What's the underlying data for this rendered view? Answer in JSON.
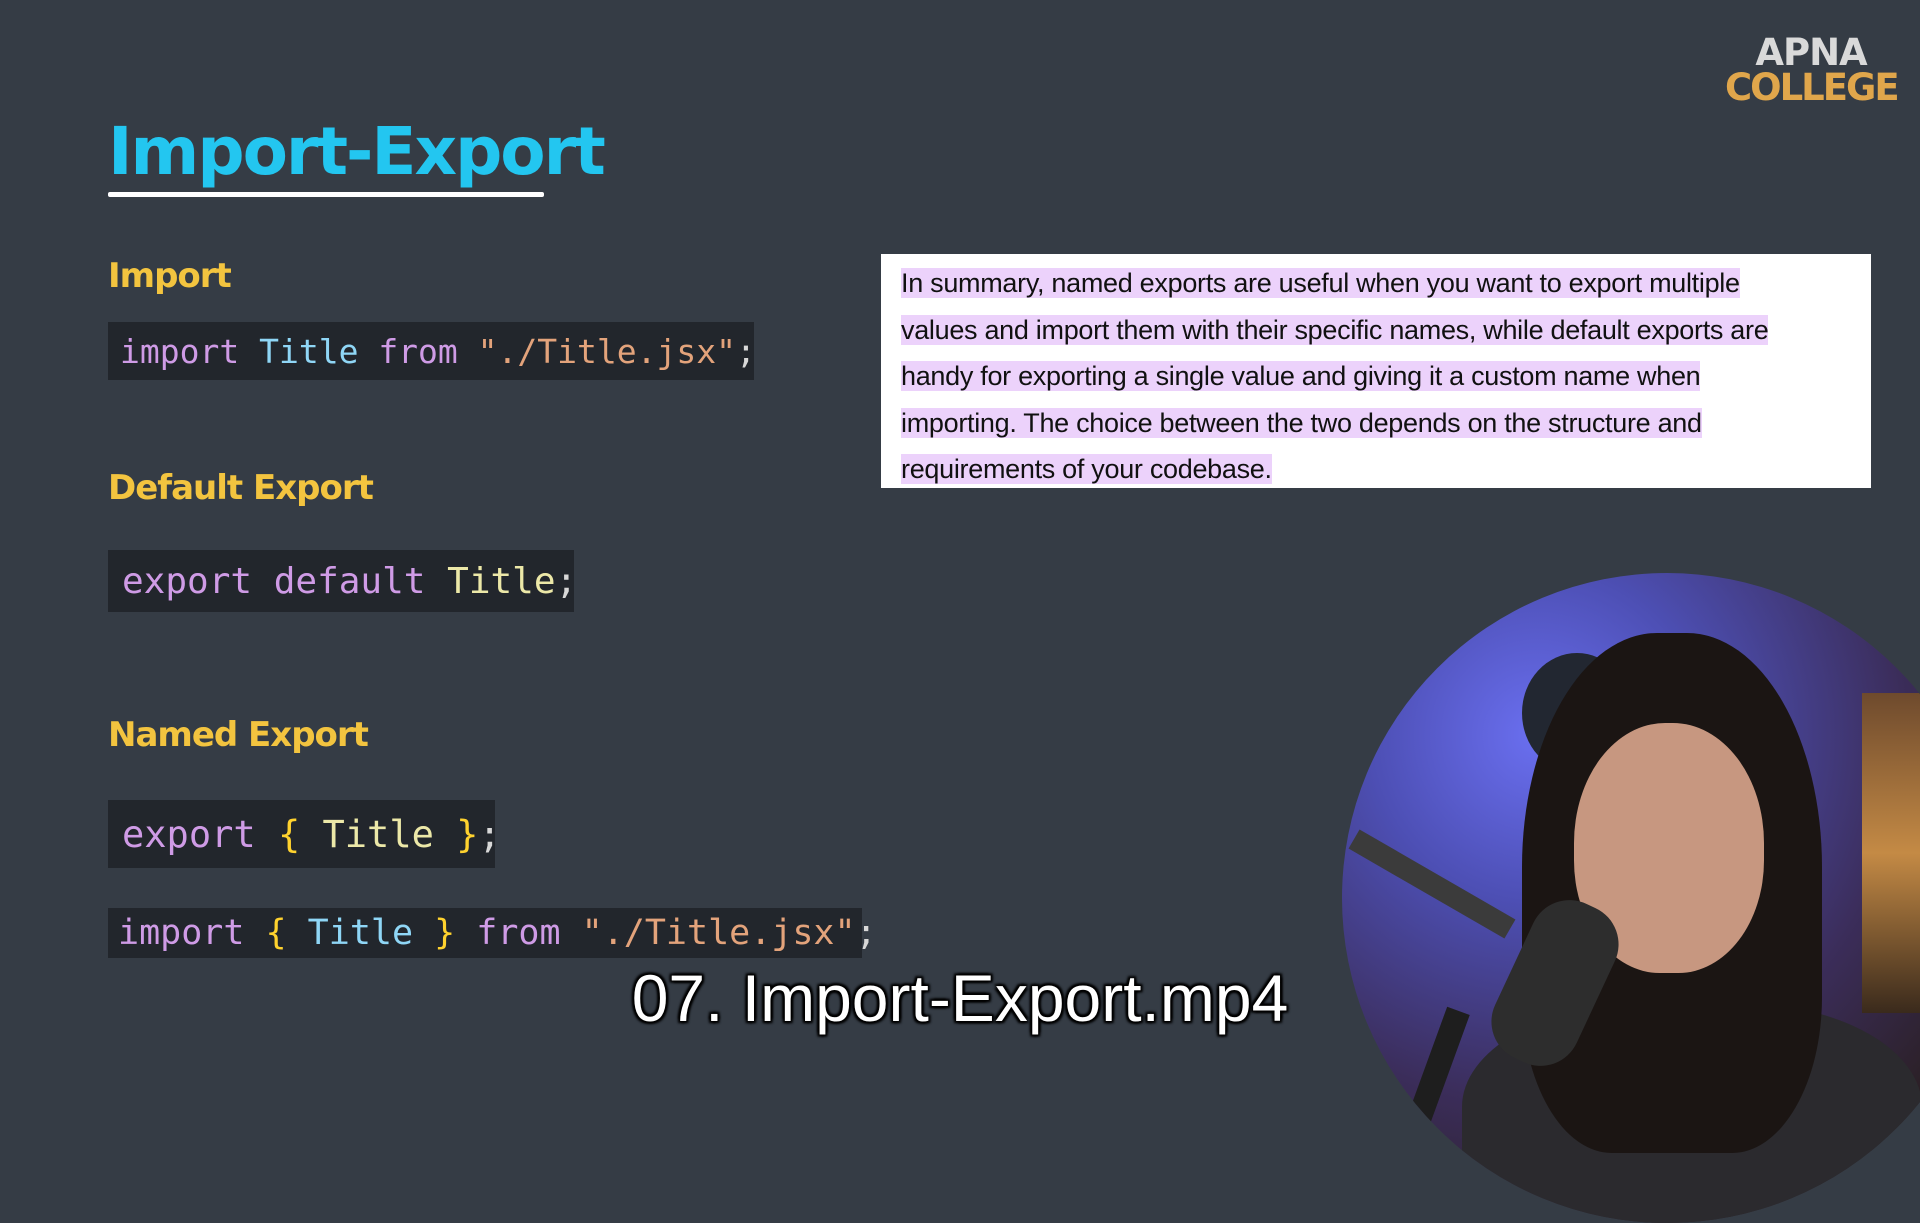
{
  "logo": {
    "line1": "APNA",
    "line2": "COLLEGE"
  },
  "page_title": "Import-Export",
  "sections": {
    "import": {
      "heading": "Import",
      "code": [
        {
          "t": "import",
          "c": "keyword"
        },
        {
          "t": " ",
          "c": "punct"
        },
        {
          "t": "Title",
          "c": "ident-blue"
        },
        {
          "t": " ",
          "c": "punct"
        },
        {
          "t": "from",
          "c": "keyword"
        },
        {
          "t": " ",
          "c": "punct"
        },
        {
          "t": "\"./Title.jsx\"",
          "c": "string"
        },
        {
          "t": ";",
          "c": "punct"
        }
      ]
    },
    "default_export": {
      "heading": "Default Export",
      "code": [
        {
          "t": "export",
          "c": "keyword"
        },
        {
          "t": " ",
          "c": "punct"
        },
        {
          "t": "default",
          "c": "keyword"
        },
        {
          "t": " ",
          "c": "punct"
        },
        {
          "t": "Title",
          "c": "ident"
        },
        {
          "t": ";",
          "c": "punct"
        }
      ]
    },
    "named_export": {
      "heading": "Named Export",
      "code_export": [
        {
          "t": "export",
          "c": "keyword"
        },
        {
          "t": " ",
          "c": "punct"
        },
        {
          "t": "{",
          "c": "brace"
        },
        {
          "t": " ",
          "c": "punct"
        },
        {
          "t": "Title",
          "c": "ident"
        },
        {
          "t": " ",
          "c": "punct"
        },
        {
          "t": "}",
          "c": "brace"
        },
        {
          "t": ";",
          "c": "punct"
        }
      ],
      "code_import": [
        {
          "t": "import",
          "c": "keyword"
        },
        {
          "t": " ",
          "c": "punct"
        },
        {
          "t": "{",
          "c": "brace"
        },
        {
          "t": " ",
          "c": "punct"
        },
        {
          "t": "Title",
          "c": "ident-blue"
        },
        {
          "t": " ",
          "c": "punct"
        },
        {
          "t": "}",
          "c": "brace"
        },
        {
          "t": " ",
          "c": "punct"
        },
        {
          "t": "from",
          "c": "keyword"
        },
        {
          "t": " ",
          "c": "punct"
        },
        {
          "t": "\"./Title.jsx\"",
          "c": "string"
        },
        {
          "t": ";",
          "c": "punct"
        }
      ]
    }
  },
  "summary_lines": [
    "In summary, named exports are useful when you want to export multiple",
    "values and import them with their specific names, while default exports are",
    "handy for exporting a single value and giving it a custom name when",
    "importing. The choice between the two depends on the structure and",
    "requirements of your codebase."
  ],
  "caption": "07. Import-Export.mp4",
  "colors": {
    "background": "#353c45",
    "title": "#23c6f0",
    "heading": "#f3c43f",
    "code_bg": "#22262c",
    "highlight": "#ecd2fb"
  },
  "webcam": {
    "content": "presenter-video"
  }
}
